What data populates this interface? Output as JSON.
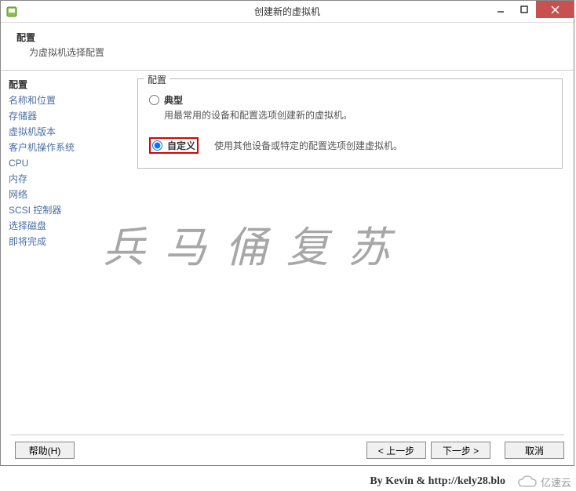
{
  "titlebar": {
    "title": "创建新的虚拟机"
  },
  "header": {
    "title": "配置",
    "subtitle": "为虚拟机选择配置"
  },
  "sidebar": {
    "items": [
      {
        "label": "配置",
        "active": true
      },
      {
        "label": "名称和位置",
        "active": false
      },
      {
        "label": "存储器",
        "active": false
      },
      {
        "label": "虚拟机版本",
        "active": false
      },
      {
        "label": "客户机操作系统",
        "active": false
      },
      {
        "label": "CPU",
        "active": false
      },
      {
        "label": "内存",
        "active": false
      },
      {
        "label": "网络",
        "active": false
      },
      {
        "label": "SCSI 控制器",
        "active": false
      },
      {
        "label": "选择磁盘",
        "active": false
      },
      {
        "label": "即将完成",
        "active": false
      }
    ]
  },
  "content": {
    "fieldset_legend": "配置",
    "options": [
      {
        "label": "典型",
        "desc": "用最常用的设备和配置选项创建新的虚拟机。",
        "selected": false
      },
      {
        "label": "自定义",
        "desc": "使用其他设备或特定的配置选项创建虚拟机。",
        "selected": true,
        "highlight": true
      }
    ]
  },
  "footer": {
    "help": "帮助(H)",
    "back": "< 上一步",
    "next": "下一步 >",
    "cancel": "取消"
  },
  "watermark": "兵马俑复苏",
  "credit": "By Kevin & http://kely28.blo",
  "cloud": "亿速云"
}
